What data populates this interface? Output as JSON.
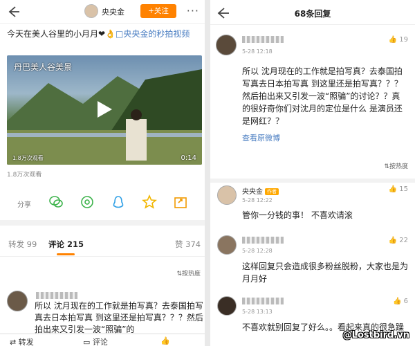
{
  "left": {
    "header": {
      "author": "央央金",
      "follow_label": "+关注",
      "more": "···"
    },
    "post": {
      "text": "今天在美人谷里的小月月❤👌",
      "link": "□央央金的秒拍视频"
    },
    "video": {
      "overlay_title": "丹巴美人谷美景",
      "play_count": "1.8万次观看",
      "duration": "0:14"
    },
    "views": "1.8万次观看",
    "share_label": "分享",
    "share_icons": [
      "wechat-icon",
      "moments-icon",
      "qq-icon",
      "qzone-icon",
      "export-icon"
    ],
    "tabs": [
      {
        "label": "转发 99"
      },
      {
        "label": "评论 215"
      },
      {
        "label": "赞 374"
      }
    ],
    "sort_label": "按热度",
    "comment": {
      "text": "所以 沈月现在的工作就是拍写真？去泰国拍写真去日本拍写真 到这里还是拍写真？？？然后拍出来又引发一波“照骗”的"
    },
    "bottom_bar": {
      "repost": "转发",
      "comment": "评论"
    }
  },
  "right": {
    "header": {
      "title": "68条回复"
    },
    "main_comment": {
      "date": "5-28 12:18",
      "likes": "19",
      "text": "所以 沈月现在的工作就是拍写真？去泰国拍写真去日本拍写真 到这里还是拍写真？？？然后拍出来又引发一波“照骗”的讨论？？真的很好奇你们对沈月的定位是什么 是演员还是网红？？",
      "view_original": "查看原微博"
    },
    "sort_label": "按热度",
    "replies": [
      {
        "name": "央央金",
        "badge": "作者",
        "date": "5-28 12:22",
        "likes": "15",
        "text": "管你一分钱的事！ 不喜欢请滚"
      },
      {
        "date": "5-28 12:28",
        "likes": "22",
        "text": "这样回复只会造成很多粉丝脱粉，大家也是为月月好"
      },
      {
        "date": "5-28 13:13",
        "likes": "6",
        "text": "不喜欢就别回复了好么。。看起来真的很急躁"
      }
    ]
  },
  "watermark": "@Lostbird.vn",
  "colors": {
    "accent": "#ff8200",
    "link": "#4a7ec2"
  }
}
